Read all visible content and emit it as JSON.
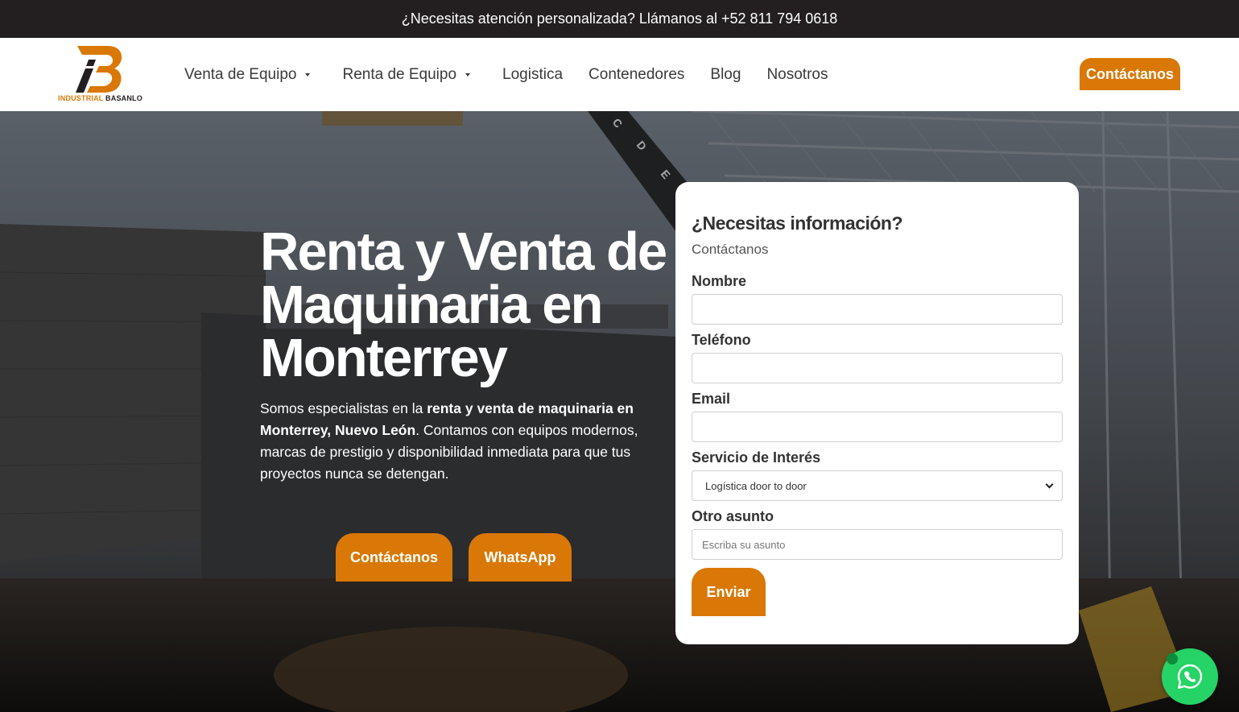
{
  "topbar": {
    "text": "¿Necesitas atención personalizada? Llámanos al +52 811 794 0618"
  },
  "brand": {
    "name_part1": "INDUSTRIAL",
    "name_part2": "BASANLO",
    "accent_color": "#d97806",
    "dark_color": "#231f20"
  },
  "nav": {
    "items": [
      {
        "label": "Venta de Equipo",
        "has_dropdown": true
      },
      {
        "label": "Renta de Equipo",
        "has_dropdown": true
      },
      {
        "label": "Logistica",
        "has_dropdown": false
      },
      {
        "label": "Contenedores",
        "has_dropdown": false
      },
      {
        "label": "Blog",
        "has_dropdown": false
      },
      {
        "label": "Nosotros",
        "has_dropdown": false
      }
    ],
    "cta_label": "Contáctanos"
  },
  "hero": {
    "title": "Renta y Venta de Maquinaria en Monterrey",
    "desc_1": "Somos especialistas en la ",
    "desc_bold": "renta y venta de maquinaria en Monterrey, Nuevo León",
    "desc_2": ". Contamos con equipos modernos, marcas de prestigio y disponibilidad inmediata para que tus proyectos nunca se detengan.",
    "btn_contact": "Contáctanos",
    "btn_whatsapp": "WhatsApp",
    "bg_letters": [
      "C",
      "D",
      "E"
    ]
  },
  "form": {
    "title": "¿Necesitas información?",
    "subtitle": "Contáctanos",
    "name_label": "Nombre",
    "phone_label": "Teléfono",
    "email_label": "Email",
    "service_label": "Servicio de Interés",
    "service_selected": "Logística door to door",
    "other_label": "Otro asunto",
    "other_placeholder": "Escriba su asunto",
    "submit_label": "Enviar"
  },
  "whatsapp_float": {
    "icon": "whatsapp-icon",
    "color": "#25d366"
  }
}
